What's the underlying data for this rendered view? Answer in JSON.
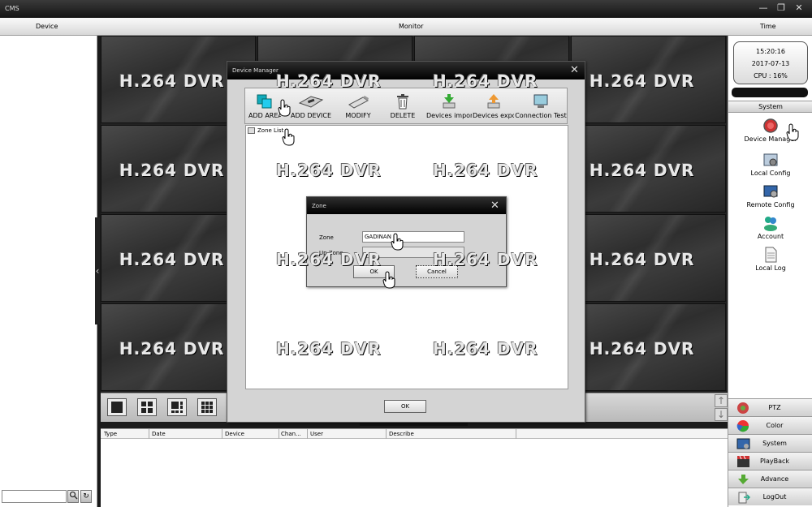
{
  "app": {
    "title": "CMS"
  },
  "menubar": {
    "device": "Device",
    "monitor": "Monitor",
    "time": "Time"
  },
  "clock": {
    "time": "15:20:16",
    "date": "2017-07-13",
    "cpu": "CPU : 16%"
  },
  "system": {
    "header": "System",
    "items": [
      {
        "label": "Device Manager",
        "icon": "device-manager-icon"
      },
      {
        "label": "Local Config",
        "icon": "local-config-icon"
      },
      {
        "label": "Remote Config",
        "icon": "remote-config-icon"
      },
      {
        "label": "Account",
        "icon": "account-icon"
      },
      {
        "label": "Local Log",
        "icon": "local-log-icon"
      }
    ]
  },
  "bottom_menu": [
    {
      "label": "PTZ",
      "icon": "ptz-icon"
    },
    {
      "label": "Color",
      "icon": "color-icon"
    },
    {
      "label": "System",
      "icon": "system-icon"
    },
    {
      "label": "PlayBack",
      "icon": "playback-icon"
    },
    {
      "label": "Advance",
      "icon": "advance-icon"
    },
    {
      "label": "LogOut",
      "icon": "logout-icon"
    }
  ],
  "video": {
    "placeholder": "H.264 DVR"
  },
  "log_table": {
    "columns": [
      "Type",
      "Date",
      "Device",
      "Chan...",
      "User",
      "Describe"
    ]
  },
  "device_manager": {
    "title": "Device Manager",
    "tools": [
      {
        "label": "ADD AREA",
        "icon": "add-area-icon"
      },
      {
        "label": "ADD DEVICE",
        "icon": "add-device-icon"
      },
      {
        "label": "MODIFY",
        "icon": "modify-icon"
      },
      {
        "label": "DELETE",
        "icon": "delete-icon"
      },
      {
        "label": "Devices import",
        "icon": "import-icon"
      },
      {
        "label": "Devices export",
        "icon": "export-icon"
      },
      {
        "label": "Connection Test",
        "icon": "connection-test-icon"
      }
    ],
    "tree_root": "Zone List",
    "ok_label": "OK"
  },
  "zone_dialog": {
    "title": "Zone",
    "zone_label": "Zone",
    "zone_value": "GADINAN",
    "up_zone_label": "Up Zone",
    "up_zone_value": "",
    "ok_label": "OK",
    "cancel_label": "Cancel"
  },
  "colors": {
    "title_bar": "#000000",
    "panel": "#d4d4d4"
  }
}
